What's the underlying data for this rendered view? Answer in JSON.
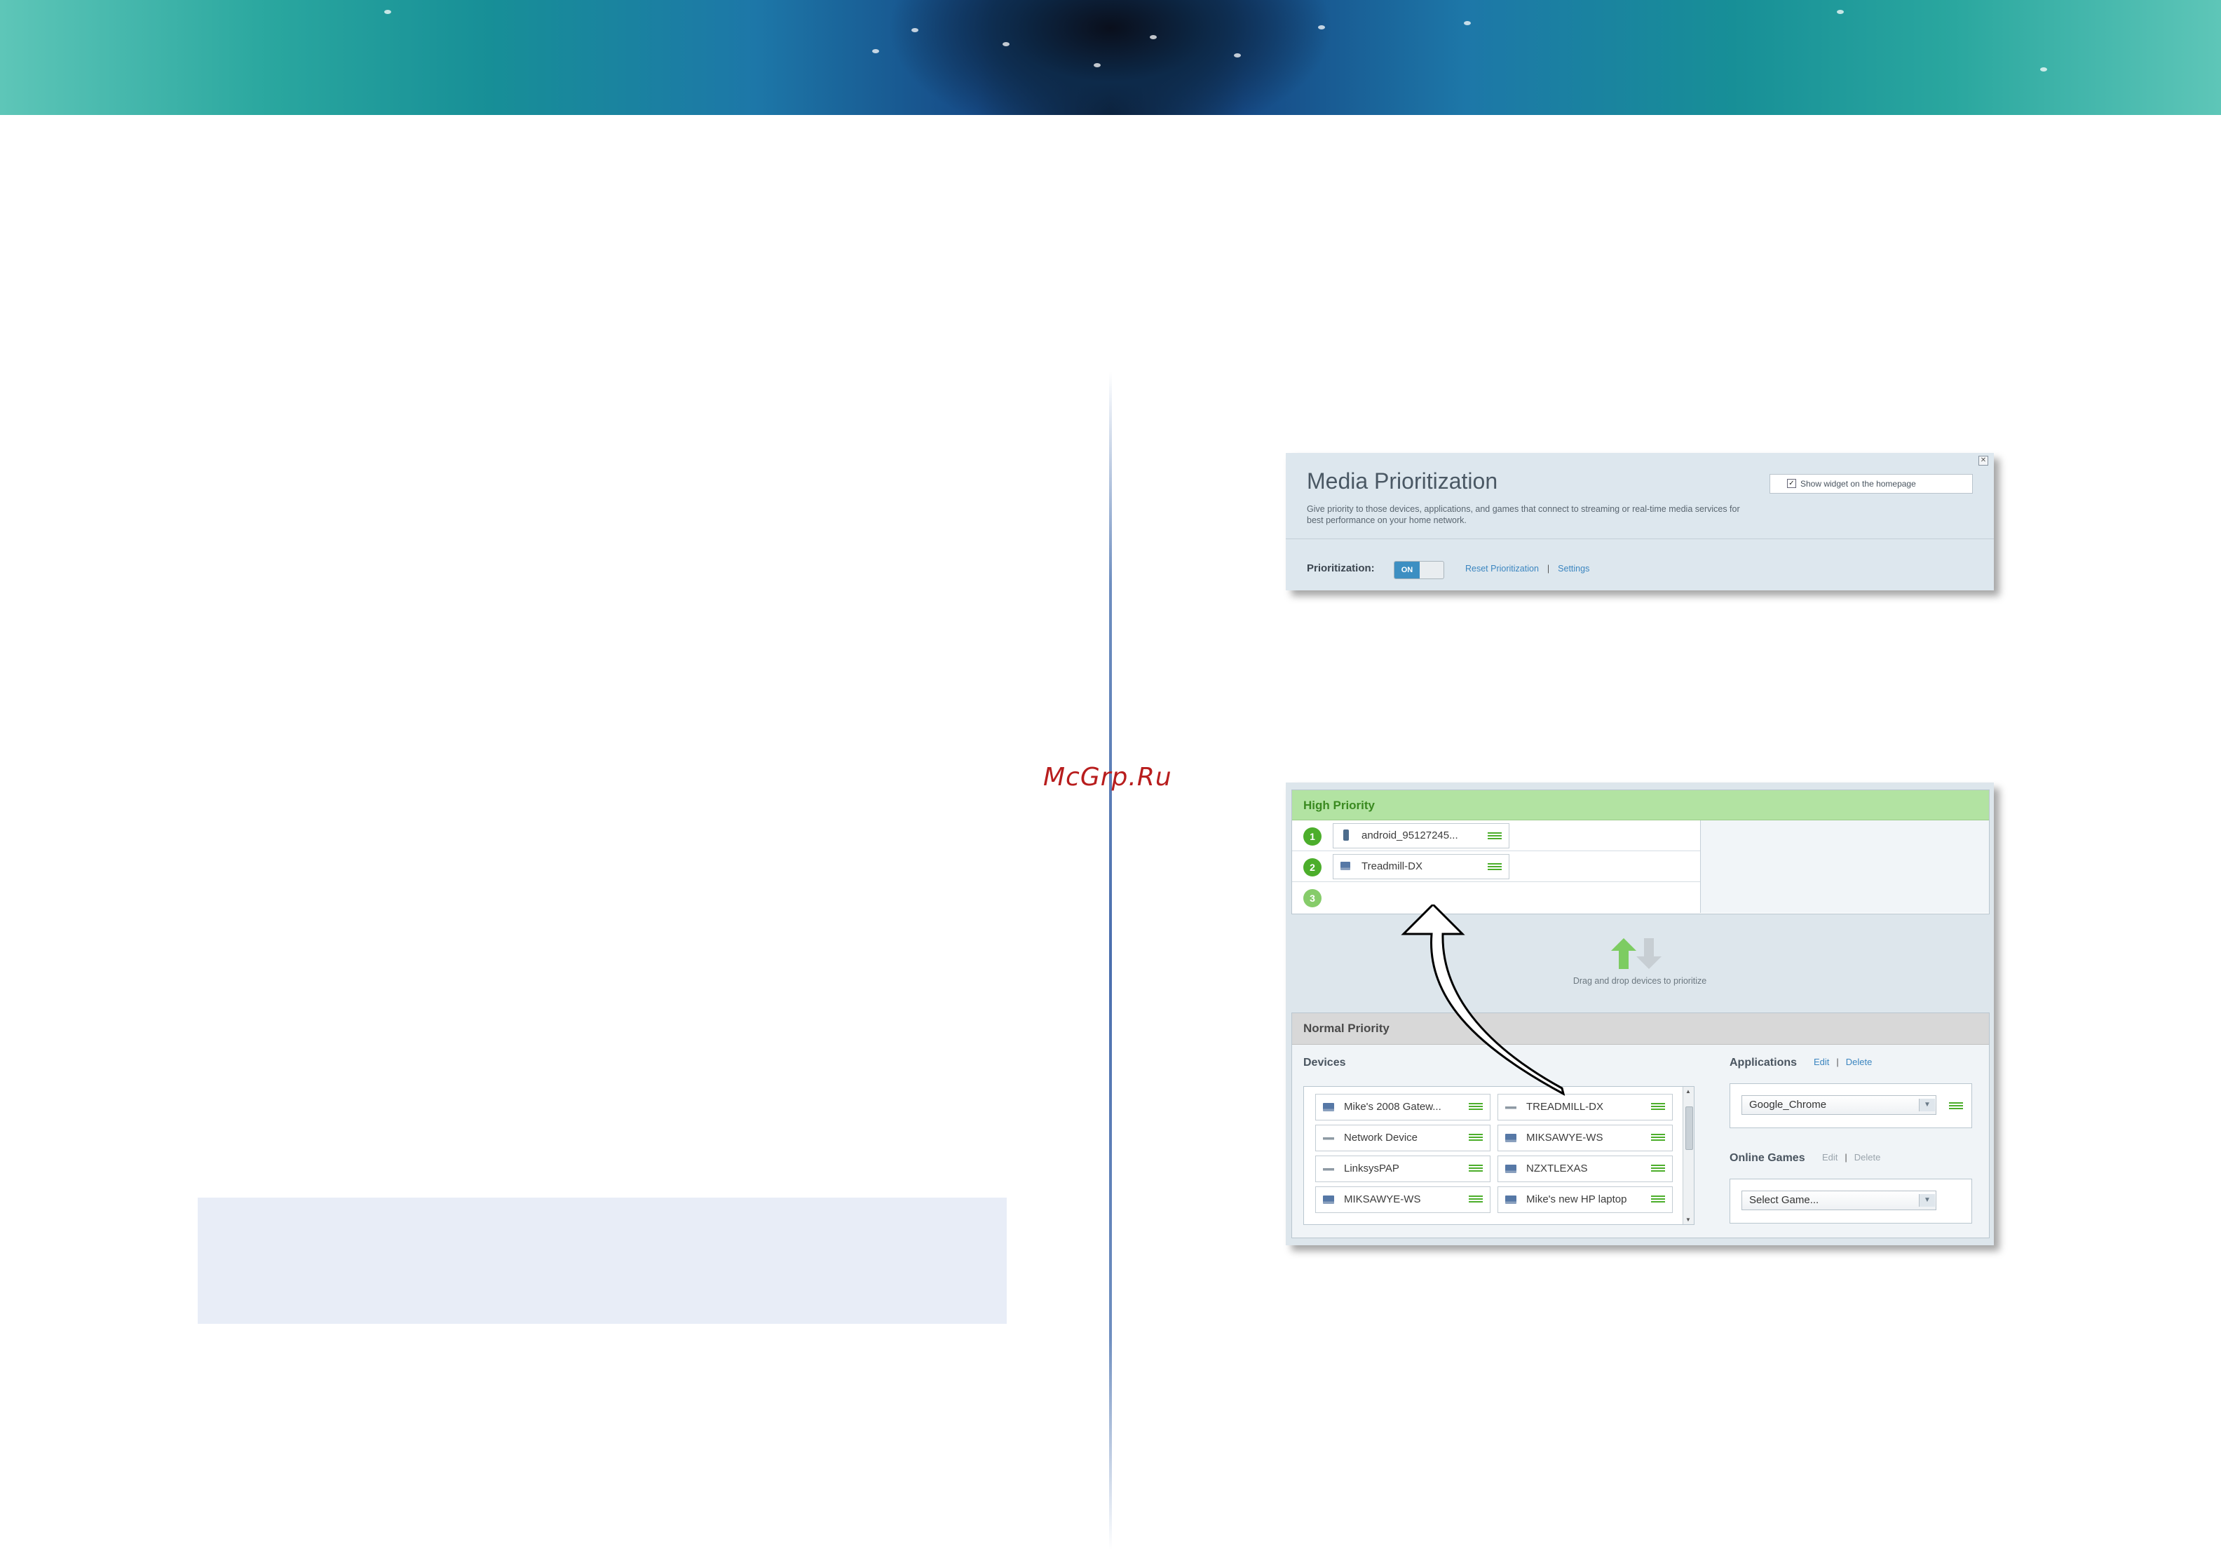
{
  "watermark": "McGrp.Ru",
  "media_widget": {
    "title": "Media Prioritization",
    "description": "Give priority to those devices, applications, and games that connect to streaming or real-time media services for best performance on your home network.",
    "show_widget_label": "Show widget on the homepage",
    "show_widget_checked": true,
    "prioritization_label": "Prioritization:",
    "toggle_state": "ON",
    "reset_link": "Reset Prioritization",
    "separator": "|",
    "settings_link": "Settings",
    "close_icon": "close-icon"
  },
  "priority_panel": {
    "high_priority_title": "High Priority",
    "slots": [
      {
        "number": "1",
        "device": "android_95127245...",
        "icon": "phone-icon"
      },
      {
        "number": "2",
        "device": "Treadmill-DX",
        "icon": "computer-icon"
      },
      {
        "number": "3",
        "device": "",
        "icon": ""
      }
    ],
    "drag_hint": "Drag and drop devices to prioritize",
    "normal_priority_title": "Normal Priority",
    "devices_label": "Devices",
    "devices": [
      {
        "name": "Mike's 2008 Gatew...",
        "icon": "computer-icon"
      },
      {
        "name": "TREADMILL-DX",
        "icon": "router-icon"
      },
      {
        "name": "Network Device",
        "icon": "router-icon"
      },
      {
        "name": "MIKSAWYE-WS",
        "icon": "computer-icon"
      },
      {
        "name": "LinksysPAP",
        "icon": "router-icon"
      },
      {
        "name": "NZXTLEXAS",
        "icon": "computer-icon"
      },
      {
        "name": "MIKSAWYE-WS",
        "icon": "computer-icon"
      },
      {
        "name": "Mike's new HP laptop",
        "icon": "computer-icon"
      }
    ],
    "applications_label": "Applications",
    "applications_edit": "Edit",
    "applications_delete": "Delete",
    "applications_selected": "Google_Chrome",
    "games_label": "Online Games",
    "games_edit": "Edit",
    "games_delete": "Delete",
    "games_selected": "Select Game...",
    "separator": "|"
  },
  "colors": {
    "high_priority_accent": "#4cae2b",
    "link_blue": "#3c86c0",
    "toggle_on": "#3d8fc2",
    "watermark_red": "#b81d1d"
  }
}
